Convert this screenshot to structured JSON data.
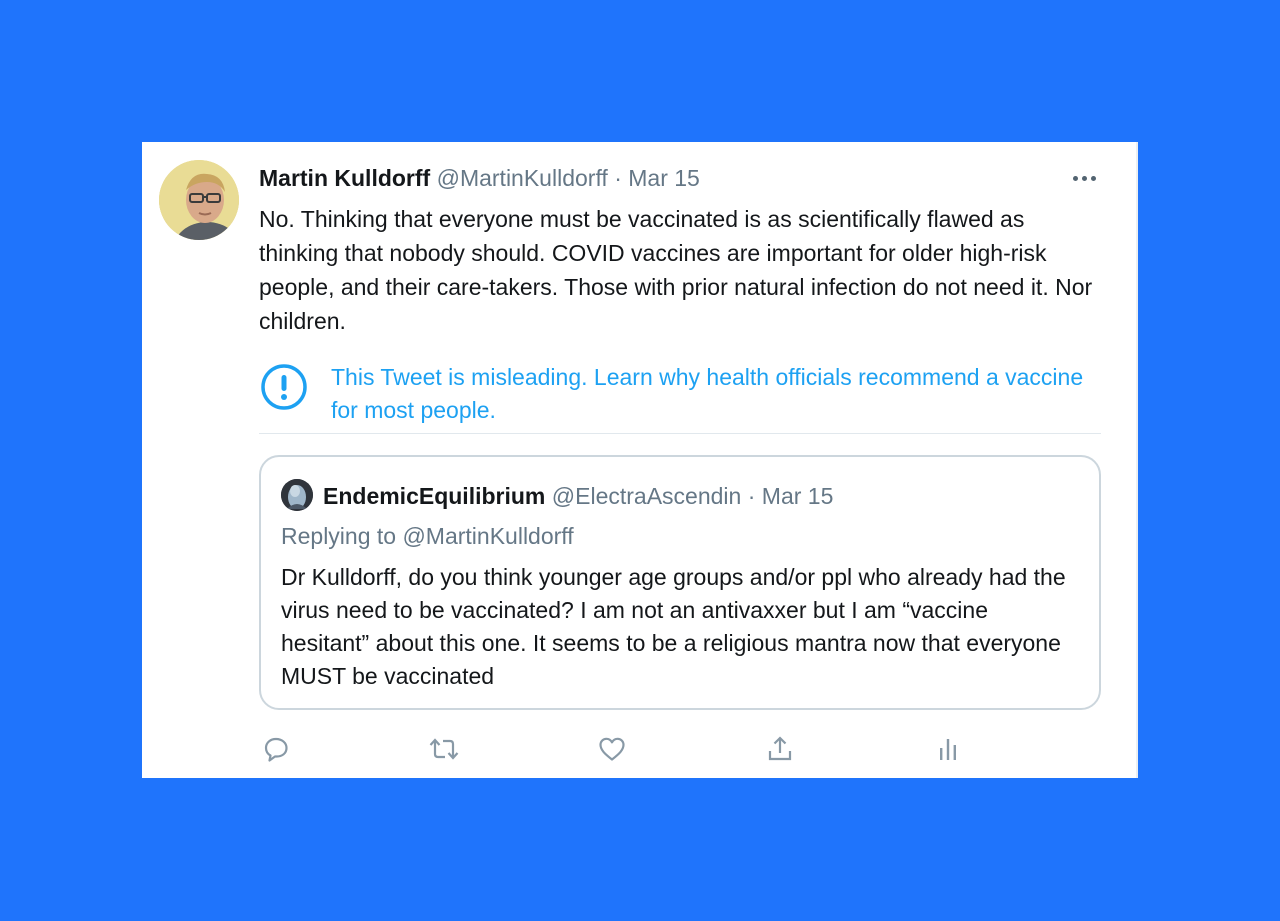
{
  "tweet": {
    "author_name": "Martin Kulldorff",
    "handle": "@MartinKulldorff",
    "separator": "·",
    "date": "Mar 15",
    "text": "No. Thinking that everyone must be vaccinated is as scientifically flawed as thinking that nobody should. COVID vaccines are important for older high-risk people, and their care-takers. Those with prior natural infection do not need it. Nor children.",
    "notice": "This Tweet is misleading. Learn why health officials recommend a vaccine for most people."
  },
  "quoted": {
    "author_name": "EndemicEquilibrium",
    "handle": "@ElectraAscendin",
    "separator": "·",
    "date": "Mar 15",
    "replying_to": "Replying to @MartinKulldorff",
    "text": "Dr Kulldorff, do you think younger age groups and/or ppl who already had the virus need to be vaccinated? I am not an antivaxxer but I am “vaccine hesitant” about this one. It seems to be a religious mantra now that everyone MUST be vaccinated"
  },
  "icons": {
    "more": "more-icon",
    "notice": "exclamation-circle-icon",
    "reply": "reply-icon",
    "retweet": "retweet-icon",
    "like": "heart-icon",
    "share": "share-icon",
    "analytics": "analytics-icon"
  },
  "colors": {
    "background": "#1f74fc",
    "link": "#1da1f2",
    "meta": "#657786",
    "text": "#14171a"
  }
}
